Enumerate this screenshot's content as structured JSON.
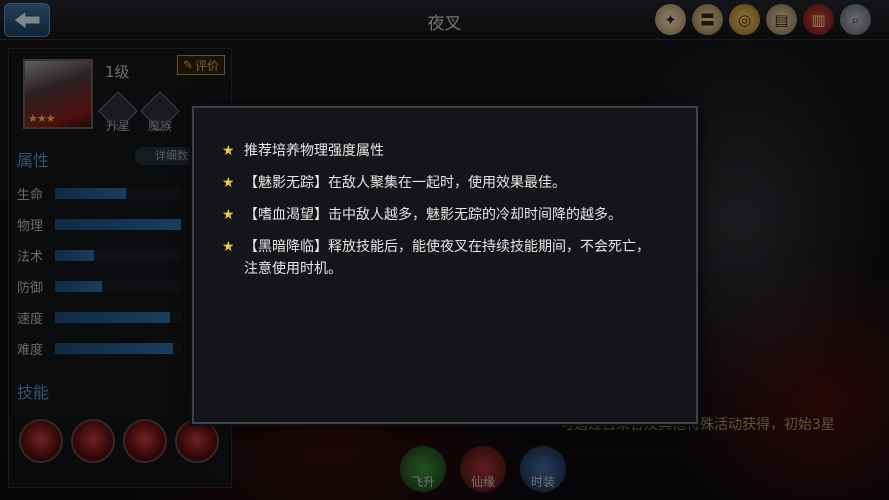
{
  "header": {
    "title": "夜叉",
    "top_icons": [
      "badge-icon",
      "scroll-icon",
      "coin-medal-icon",
      "map-icon",
      "book-icon",
      "magnifier-icon"
    ]
  },
  "hero": {
    "level": "1级",
    "stars": "★★★",
    "rate_label": "评价",
    "emblems": [
      "升星",
      "魔族"
    ]
  },
  "attributes": {
    "title": "属性",
    "detail_label": "详细数",
    "stats": [
      {
        "label": "生命",
        "value": 0.56
      },
      {
        "label": "物理",
        "value": 1.0
      },
      {
        "label": "法术",
        "value": 0.31
      },
      {
        "label": "防御",
        "value": 0.37
      },
      {
        "label": "速度",
        "value": 0.91
      },
      {
        "label": "难度",
        "value": 0.94
      }
    ]
  },
  "skills": {
    "title": "技能",
    "count": 4
  },
  "bottom": {
    "note": "可通过古来合及其他特殊活动获得，初始3星",
    "buttons": [
      "飞升",
      "仙缘",
      "时装"
    ]
  },
  "tips": [
    "推荐培养物理强度属性",
    "【魅影无踪】在敌人聚集在一起时，使用效果最佳。",
    "【嗜血渴望】击中敌人越多，魅影无踪的冷却时间降的越多。",
    "【黑暗降临】释放技能后，能使夜叉在持续技能期间，不会死亡，注意使用时机。"
  ],
  "colors": {
    "accent_blue": "#2c6aa5",
    "star_gold": "#f4c641",
    "modal_bg": "#141518"
  }
}
